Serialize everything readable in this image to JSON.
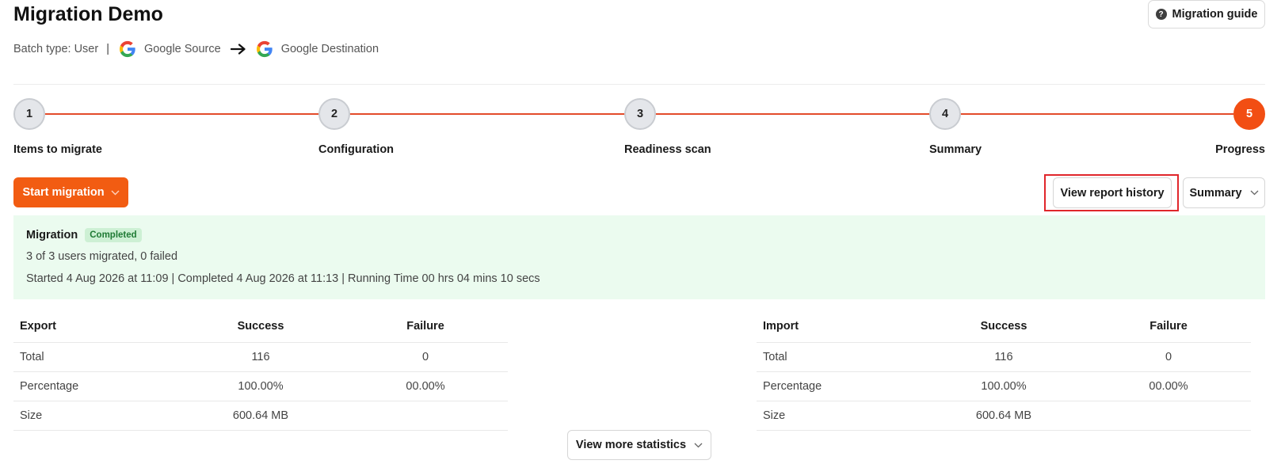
{
  "header": {
    "title": "Migration Demo",
    "guide_button": "Migration guide",
    "guide_icon": "help-circle-icon"
  },
  "batch": {
    "type_text": "Batch type: User",
    "separator": "|",
    "source_label": "Google Source",
    "destination_label": "Google Destination"
  },
  "stepper": {
    "active_color": "#f24e13",
    "line_color": "#e34b2a",
    "steps": [
      {
        "number": "1",
        "label": "Items to migrate"
      },
      {
        "number": "2",
        "label": "Configuration"
      },
      {
        "number": "3",
        "label": "Readiness scan"
      },
      {
        "number": "4",
        "label": "Summary"
      },
      {
        "number": "5",
        "label": "Progress",
        "active": true
      }
    ]
  },
  "actions": {
    "start_migration": "Start migration",
    "view_report_history": "View report history",
    "view_select": "Summary"
  },
  "status": {
    "title": "Migration",
    "badge": "Completed",
    "summary_line": "3 of 3 users migrated, 0 failed",
    "timing_line": "Started 4 Aug 2026 at 11:09 | Completed 4 Aug 2026 at 11:13 | Running Time 00 hrs 04 mins 10 secs"
  },
  "export_table": {
    "headers": [
      "Export",
      "Success",
      "Failure"
    ],
    "rows": [
      [
        "Total",
        "116",
        "0"
      ],
      [
        "Percentage",
        "100.00%",
        "00.00%"
      ],
      [
        "Size",
        "600.64 MB",
        ""
      ]
    ]
  },
  "import_table": {
    "headers": [
      "Import",
      "Success",
      "Failure"
    ],
    "rows": [
      [
        "Total",
        "116",
        "0"
      ],
      [
        "Percentage",
        "100.00%",
        "00.00%"
      ],
      [
        "Size",
        "600.64 MB",
        ""
      ]
    ]
  },
  "more_stats_button": "View more statistics"
}
